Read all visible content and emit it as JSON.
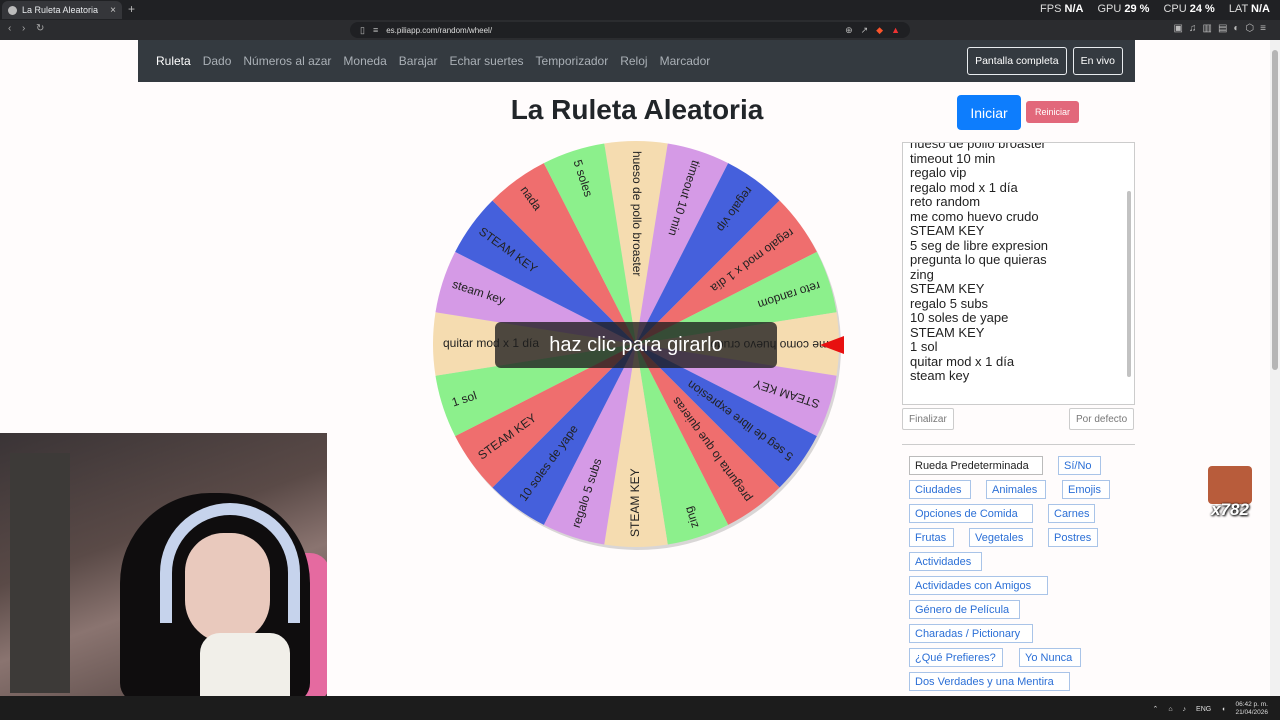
{
  "browser": {
    "tab_title": "La Ruleta Aleatoria",
    "tab_close": "×",
    "new_tab": "+",
    "url": "es.piliapp.com/random/wheel/",
    "stats": [
      {
        "label": "FPS",
        "value": "N/A"
      },
      {
        "label": "GPU",
        "value": "29 %"
      },
      {
        "label": "CPU",
        "value": "24 %"
      },
      {
        "label": "LAT",
        "value": "N/A"
      }
    ]
  },
  "nav": {
    "brand": "Ruleta",
    "links": [
      "Dado",
      "Números al azar",
      "Moneda",
      "Barajar",
      "Echar suertes",
      "Temporizador",
      "Reloj",
      "Marcador"
    ],
    "fullscreen": "Pantalla completa",
    "live": "En vivo"
  },
  "page": {
    "title": "La Ruleta Aleatoria",
    "start": "Iniciar",
    "reset": "Reiniciar",
    "spin_hint": "haz clic para girarlo"
  },
  "wheel": {
    "segments": [
      {
        "label": "hueso de pollo broaster",
        "color": "#f5dcb0"
      },
      {
        "label": "timeout 10 min",
        "color": "#d59ae6"
      },
      {
        "label": "regalo vip",
        "color": "#4560dc"
      },
      {
        "label": "regalo mod x 1 día",
        "color": "#ef6e6e"
      },
      {
        "label": "reto random",
        "color": "#8cf08c"
      },
      {
        "label": "me como huevo crudo",
        "color": "#f5dcb0"
      },
      {
        "label": "STEAM KEY",
        "color": "#d59ae6"
      },
      {
        "label": "5 seg de libre expresion",
        "color": "#4560dc"
      },
      {
        "label": "pregunta lo que quieras",
        "color": "#ef6e6e"
      },
      {
        "label": "zing",
        "color": "#8cf08c"
      },
      {
        "label": "STEAM KEY",
        "color": "#f5dcb0"
      },
      {
        "label": "regalo 5 subs",
        "color": "#d59ae6"
      },
      {
        "label": "10 soles de yape",
        "color": "#4560dc"
      },
      {
        "label": "STEAM KEY",
        "color": "#ef6e6e"
      },
      {
        "label": "1 sol",
        "color": "#8cf08c"
      },
      {
        "label": "quitar mod x 1 día",
        "color": "#f5dcb0"
      },
      {
        "label": "steam key",
        "color": "#d59ae6"
      },
      {
        "label": "STEAM KEY",
        "color": "#4560dc"
      },
      {
        "label": "nada",
        "color": "#ef6e6e"
      },
      {
        "label": "5 soles",
        "color": "#8cf08c"
      }
    ]
  },
  "list": {
    "items": [
      "hueso de pollo broaster",
      "timeout 10 min",
      "regalo vip",
      "regalo mod x 1 día",
      "reto random",
      "me como huevo crudo",
      "STEAM KEY",
      "5 seg de libre expresion",
      "pregunta lo que quieras",
      "zing",
      "STEAM KEY",
      "regalo 5 subs",
      "10 soles de yape",
      "STEAM KEY",
      "1 sol",
      "quitar mod x 1 día",
      "steam key"
    ],
    "finish": "Finalizar",
    "default": "Por defecto"
  },
  "presets": [
    {
      "label": "Rueda Predeterminada",
      "dark": true
    },
    {
      "label": "Sí/No"
    },
    {
      "label": "Ciudades"
    },
    {
      "label": "Animales"
    },
    {
      "label": "Emojis"
    },
    {
      "label": "Opciones de Comida"
    },
    {
      "label": "Carnes"
    },
    {
      "label": "Frutas"
    },
    {
      "label": "Vegetales"
    },
    {
      "label": "Postres"
    },
    {
      "label": "Actividades"
    },
    {
      "label": "Actividades con Amigos"
    },
    {
      "label": "Género de Película"
    },
    {
      "label": "Charadas / Pictionary"
    },
    {
      "label": "¿Qué Prefieres?"
    },
    {
      "label": "Yo Nunca"
    },
    {
      "label": "Dos Verdades y una Mentira"
    }
  ],
  "overlay": {
    "emote_count": "x782"
  },
  "taskbar": {
    "lang": "ENG",
    "time": "06:42 p. m.",
    "date": "21/04/2026"
  }
}
